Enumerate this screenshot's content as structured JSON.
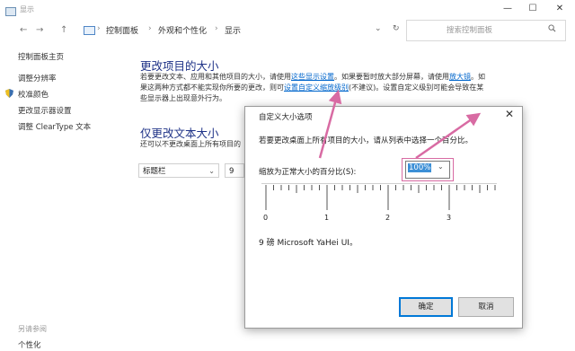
{
  "window": {
    "title": "显示",
    "min": "—",
    "max": "☐",
    "close": "✕"
  },
  "nav": {
    "back": "←",
    "forward": "→",
    "up": "↑",
    "crumbs": [
      "控制面板",
      "外观和个性化",
      "显示"
    ],
    "sep": "›",
    "dropdown": "⌄",
    "refresh": "↻",
    "search_placeholder": "搜索控制面板"
  },
  "sidebar": {
    "items": [
      "控制面板主页",
      "调整分辨率",
      "校准颜色",
      "更改显示器设置",
      "调整 ClearType 文本"
    ]
  },
  "main": {
    "section1_title": "更改项目的大小",
    "para1_a": "若要更改文本、应用和其他项目的大小，请使用",
    "para1_link1": "这些显示设置",
    "para1_b": "。如果要暂时放大部分屏幕，请使用",
    "para1_link2": "放大镜",
    "para1_c": "。如",
    "para2_a": "果这两种方式都不能实现你所要的更改，则可",
    "para2_link": "设置自定义缩放级别",
    "para2_b": "(不建议)。设置自定义级别可能会导致在某",
    "para3": "些显示器上出现意外行为。",
    "section2_title": "仅更改文本大小",
    "para4": "还可以不更改桌面上所有项目的",
    "select1": "标题栏",
    "select2": "9",
    "select_chev": "⌄"
  },
  "footer": {
    "heading": "另请参阅",
    "link": "个性化"
  },
  "dialog": {
    "title": "自定义大小选项",
    "close": "✕",
    "instruction": "若要更改桌面上所有项目的大小，请从列表中选择一个百分比。",
    "scale_label": "缩放为正常大小的百分比(S):",
    "percent": "100%",
    "ruler_labels": [
      "0",
      "1",
      "2",
      "3"
    ],
    "sample": "9 磅 Microsoft YaHei UI。",
    "ok": "确定",
    "cancel": "取消"
  },
  "colors": {
    "title_blue": "#1e3287",
    "link_blue": "#0066cc",
    "annotation_pink": "#d86ba3",
    "selection_blue": "#3c8fd6"
  }
}
